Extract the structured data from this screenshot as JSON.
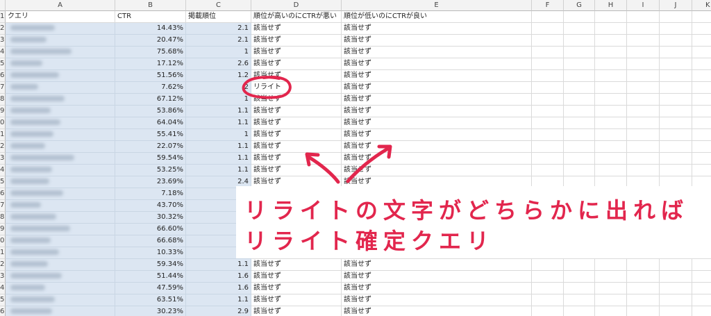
{
  "spreadsheet": {
    "column_headers": [
      "A",
      "B",
      "C",
      "D",
      "E",
      "F",
      "G",
      "H",
      "I",
      "J",
      "K"
    ],
    "header_row": {
      "row_label": "1",
      "cells": [
        "クエリ",
        "CTR",
        "掲載順位",
        "順位が高いのにCTRが悪い",
        "順位が低いのにCTRが良い"
      ]
    },
    "rows": [
      {
        "row_label": "2",
        "ctr": "14.43%",
        "position": "2.1",
        "high_rank_low_ctr": "該当せず",
        "low_rank_high_ctr": "該当せず"
      },
      {
        "row_label": "3",
        "ctr": "20.47%",
        "position": "2.1",
        "high_rank_low_ctr": "該当せず",
        "low_rank_high_ctr": "該当せず"
      },
      {
        "row_label": "4",
        "ctr": "75.68%",
        "position": "1",
        "high_rank_low_ctr": "該当せず",
        "low_rank_high_ctr": "該当せず"
      },
      {
        "row_label": "5",
        "ctr": "17.12%",
        "position": "2.6",
        "high_rank_low_ctr": "該当せず",
        "low_rank_high_ctr": "該当せず"
      },
      {
        "row_label": "6",
        "ctr": "51.56%",
        "position": "1.2",
        "high_rank_low_ctr": "該当せず",
        "low_rank_high_ctr": "該当せず"
      },
      {
        "row_label": "7",
        "ctr": "7.62%",
        "position": "2",
        "high_rank_low_ctr": "リライト",
        "low_rank_high_ctr": "該当せず"
      },
      {
        "row_label": "8",
        "ctr": "67.12%",
        "position": "1",
        "high_rank_low_ctr": "該当せず",
        "low_rank_high_ctr": "該当せず"
      },
      {
        "row_label": "9",
        "ctr": "53.86%",
        "position": "1.1",
        "high_rank_low_ctr": "該当せず",
        "low_rank_high_ctr": "該当せず"
      },
      {
        "row_label": "0",
        "ctr": "64.04%",
        "position": "1.1",
        "high_rank_low_ctr": "該当せず",
        "low_rank_high_ctr": "該当せず"
      },
      {
        "row_label": "1",
        "ctr": "55.41%",
        "position": "1",
        "high_rank_low_ctr": "該当せず",
        "low_rank_high_ctr": "該当せず"
      },
      {
        "row_label": "2",
        "ctr": "22.07%",
        "position": "1.1",
        "high_rank_low_ctr": "該当せず",
        "low_rank_high_ctr": "該当せず"
      },
      {
        "row_label": "3",
        "ctr": "59.54%",
        "position": "1.1",
        "high_rank_low_ctr": "該当せず",
        "low_rank_high_ctr": "該当せず"
      },
      {
        "row_label": "4",
        "ctr": "53.25%",
        "position": "1.1",
        "high_rank_low_ctr": "該当せず",
        "low_rank_high_ctr": "該当せず"
      },
      {
        "row_label": "5",
        "ctr": "23.69%",
        "position": "2.4",
        "high_rank_low_ctr": "該当せず",
        "low_rank_high_ctr": "該当せず"
      },
      {
        "row_label": "6",
        "ctr": "7.18%"
      },
      {
        "row_label": "7",
        "ctr": "43.70%"
      },
      {
        "row_label": "8",
        "ctr": "30.32%"
      },
      {
        "row_label": "9",
        "ctr": "66.60%"
      },
      {
        "row_label": "0",
        "ctr": "66.68%"
      },
      {
        "row_label": "1",
        "ctr": "10.33%"
      },
      {
        "row_label": "2",
        "ctr": "59.34%",
        "position": "1.1",
        "high_rank_low_ctr": "該当せず",
        "low_rank_high_ctr": "該当せず"
      },
      {
        "row_label": "3",
        "ctr": "51.44%",
        "position": "1.6",
        "high_rank_low_ctr": "該当せず",
        "low_rank_high_ctr": "該当せず"
      },
      {
        "row_label": "4",
        "ctr": "47.59%",
        "position": "1.6",
        "high_rank_low_ctr": "該当せず",
        "low_rank_high_ctr": "該当せず"
      },
      {
        "row_label": "5",
        "ctr": "63.51%",
        "position": "1.1",
        "high_rank_low_ctr": "該当せず",
        "low_rank_high_ctr": "該当せず"
      },
      {
        "row_label": "6",
        "ctr": "30.23%",
        "position": "2.9",
        "high_rank_low_ctr": "該当せず",
        "low_rank_high_ctr": "該当せず"
      }
    ]
  },
  "annotation": {
    "line1": "リライトの文字がどちらかに出れば",
    "line2": "リライト確定クエリ"
  },
  "colors": {
    "annotation_red": "#e2264d",
    "selection_blue": "#dce6f2"
  }
}
